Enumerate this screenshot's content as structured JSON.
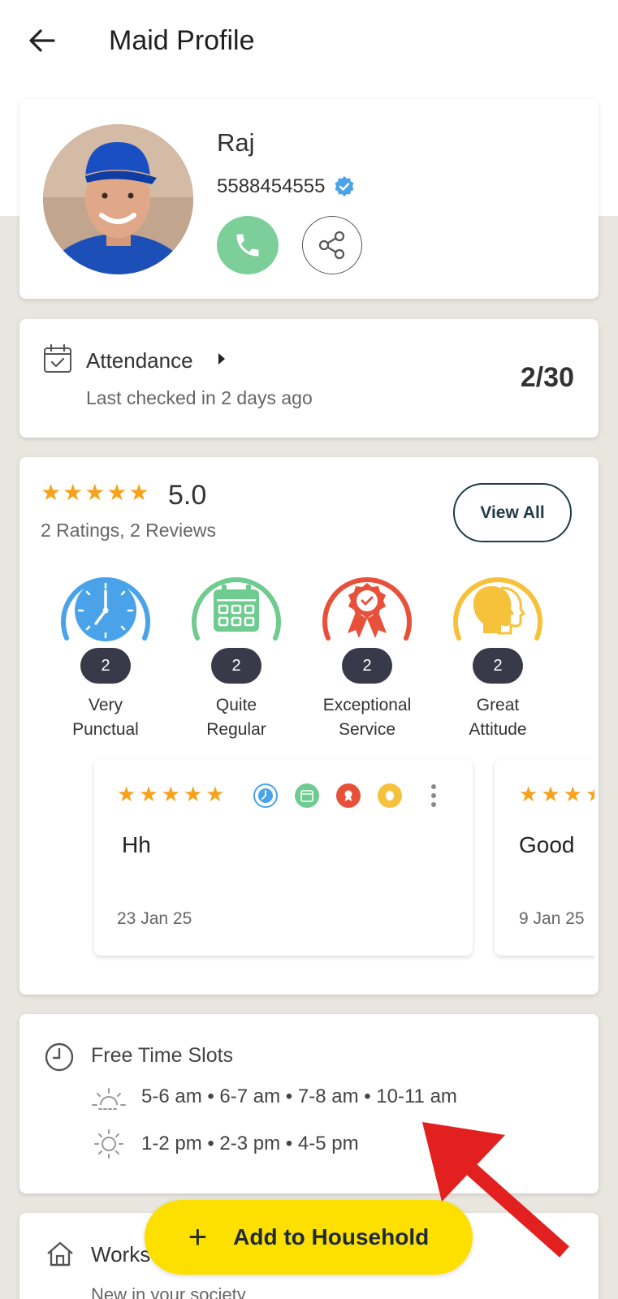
{
  "header": {
    "title": "Maid Profile"
  },
  "profile": {
    "name": "Raj",
    "phone": "5588454555"
  },
  "attendance": {
    "title": "Attendance",
    "subtitle": "Last checked in 2 days ago",
    "count": "2/30"
  },
  "ratings": {
    "stars": 5,
    "value": "5.0",
    "summary": "2 Ratings, 2 Reviews",
    "view_all_label": "View All",
    "badges": [
      {
        "line1": "Very",
        "line2": "Punctual",
        "count": "2",
        "color": "#4aa3e8"
      },
      {
        "line1": "Quite",
        "line2": "Regular",
        "count": "2",
        "color": "#6fcb8f"
      },
      {
        "line1": "Exceptional",
        "line2": "Service",
        "count": "2",
        "color": "#e8503a"
      },
      {
        "line1": "Great",
        "line2": "Attitude",
        "count": "2",
        "color": "#f7c23b"
      }
    ],
    "reviews": [
      {
        "text": "Hh",
        "date": "23 Jan 25",
        "stars": 5
      },
      {
        "text": "Good",
        "date": "9 Jan 25",
        "stars": 5
      }
    ]
  },
  "free_time": {
    "title": "Free Time Slots",
    "morning": "5-6 am • 6-7 am • 7-8 am • 10-11 am",
    "afternoon": "1-2 pm • 2-3 pm • 4-5 pm"
  },
  "works": {
    "title": "Works",
    "subtitle": "New in your society"
  },
  "fab": {
    "label": "Add to Household"
  },
  "colors": {
    "accent_yellow": "#fde000",
    "star": "#f6a21b",
    "call_green": "#7ccf99",
    "verified_blue": "#4aa3e8",
    "annotation_red": "#e32020"
  }
}
